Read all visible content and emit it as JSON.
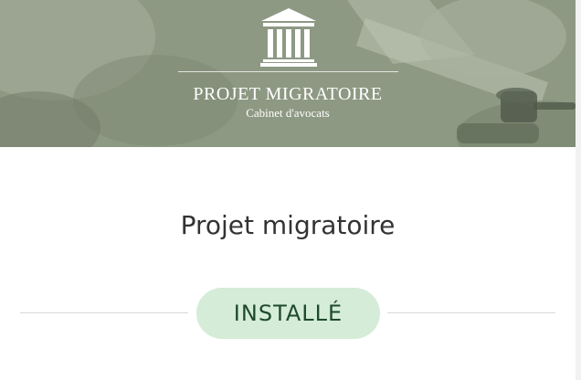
{
  "banner": {
    "logo_icon": "courthouse-columns-icon",
    "firm_name": "PROJET MIGRATOIRE",
    "firm_subtitle": "Cabinet d'avocats"
  },
  "app": {
    "title": "Projet migratoire",
    "status_badge": "INSTALLÉ"
  },
  "colors": {
    "banner_tint": "#8f9a85",
    "badge_bg": "#d4ecd8",
    "badge_text": "#1f4a2b",
    "title_text": "#333333"
  }
}
